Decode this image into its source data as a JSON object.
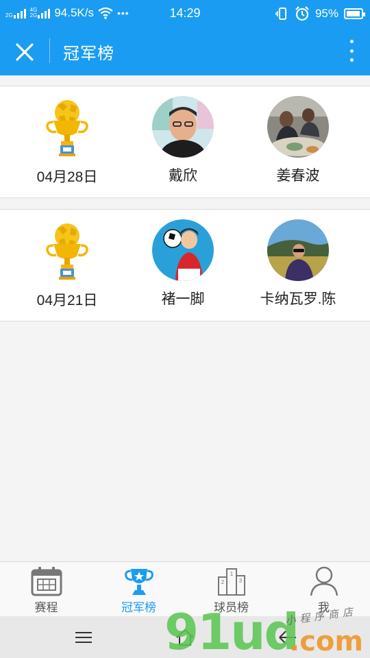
{
  "status_bar": {
    "net_tag_top": "2G",
    "net_tag_mid1": "4G",
    "net_tag_mid2": "2G",
    "speed": "94.5K/s",
    "dots": "•••",
    "time": "14:29",
    "battery": "95%"
  },
  "header": {
    "title": "冠军榜",
    "accent_color": "#1a9cf2"
  },
  "weeks": [
    {
      "date": "04月28日",
      "first": "戴欣",
      "second": "姜春波"
    },
    {
      "date": "04月21日",
      "first": "褚一脚",
      "second": "卡纳瓦罗.陈"
    }
  ],
  "tabs": [
    {
      "label": "赛程",
      "icon": "calendar-icon",
      "active": false
    },
    {
      "label": "冠军榜",
      "icon": "trophy-icon",
      "active": true
    },
    {
      "label": "球员榜",
      "icon": "podium-icon",
      "active": false
    },
    {
      "label": "我",
      "icon": "person-icon",
      "active": false
    }
  ],
  "podium_numbers": [
    "1",
    "2",
    "3"
  ],
  "watermark": {
    "main": "91ud",
    "domain": ".com",
    "tagline": "小程序商店"
  }
}
